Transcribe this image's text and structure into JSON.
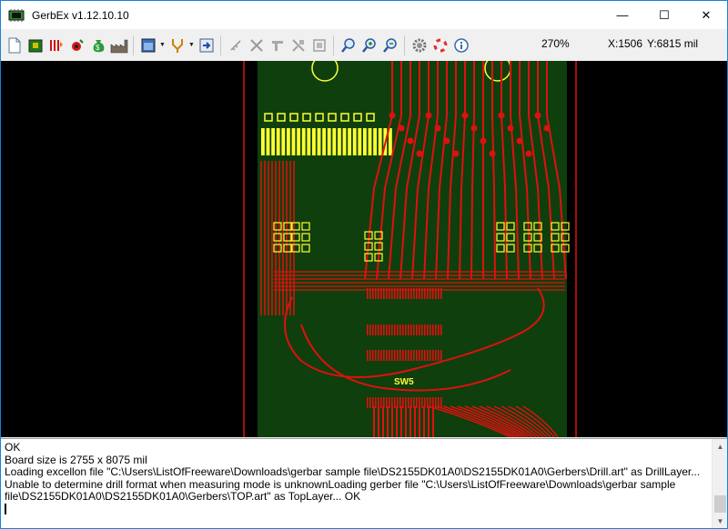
{
  "window": {
    "title": "GerbEx v1.12.10.10",
    "controls": {
      "minimize": "—",
      "maximize": "☐",
      "close": "✕"
    }
  },
  "toolbar": {
    "groups": [
      [
        "new-file-icon",
        "open-project-icon",
        "load-layers-icon",
        "drill-icon",
        "money-bag-icon",
        "factory-icon"
      ],
      [
        "layer-view-icon",
        "probe-icon",
        "export-icon"
      ],
      [
        "ruler-icon",
        "cut-icon",
        "flip-icon",
        "mirror-icon",
        "fit-board-icon"
      ],
      [
        "zoom-icon",
        "zoom-in-icon",
        "zoom-out-icon"
      ],
      [
        "settings-gear-icon",
        "help-lifebuoy-icon",
        "info-icon"
      ]
    ],
    "zoom": "270%",
    "coord_x": "X:1506",
    "coord_y": "Y:6815 mil"
  },
  "canvas": {
    "background": "#000000",
    "board_color": "#0f3f0d",
    "trace_color": "#e01010",
    "drill_color": "#ffff33",
    "silk_label": "SW5"
  },
  "log": {
    "lines": [
      "OK",
      "Board size is 2755 x 8075 mil",
      "Loading excellon file \"C:\\Users\\ListOfFreeware\\Downloads\\gerbar sample file\\DS2155DK01A0\\DS2155DK01A0\\Gerbers\\Drill.art\" as DrillLayer... Unable to determine drill format when measuring mode is unknownLoading gerber file \"C:\\Users\\ListOfFreeware\\Downloads\\gerbar sample file\\DS2155DK01A0\\DS2155DK01A0\\Gerbers\\TOP.art\" as TopLayer... OK"
    ]
  }
}
